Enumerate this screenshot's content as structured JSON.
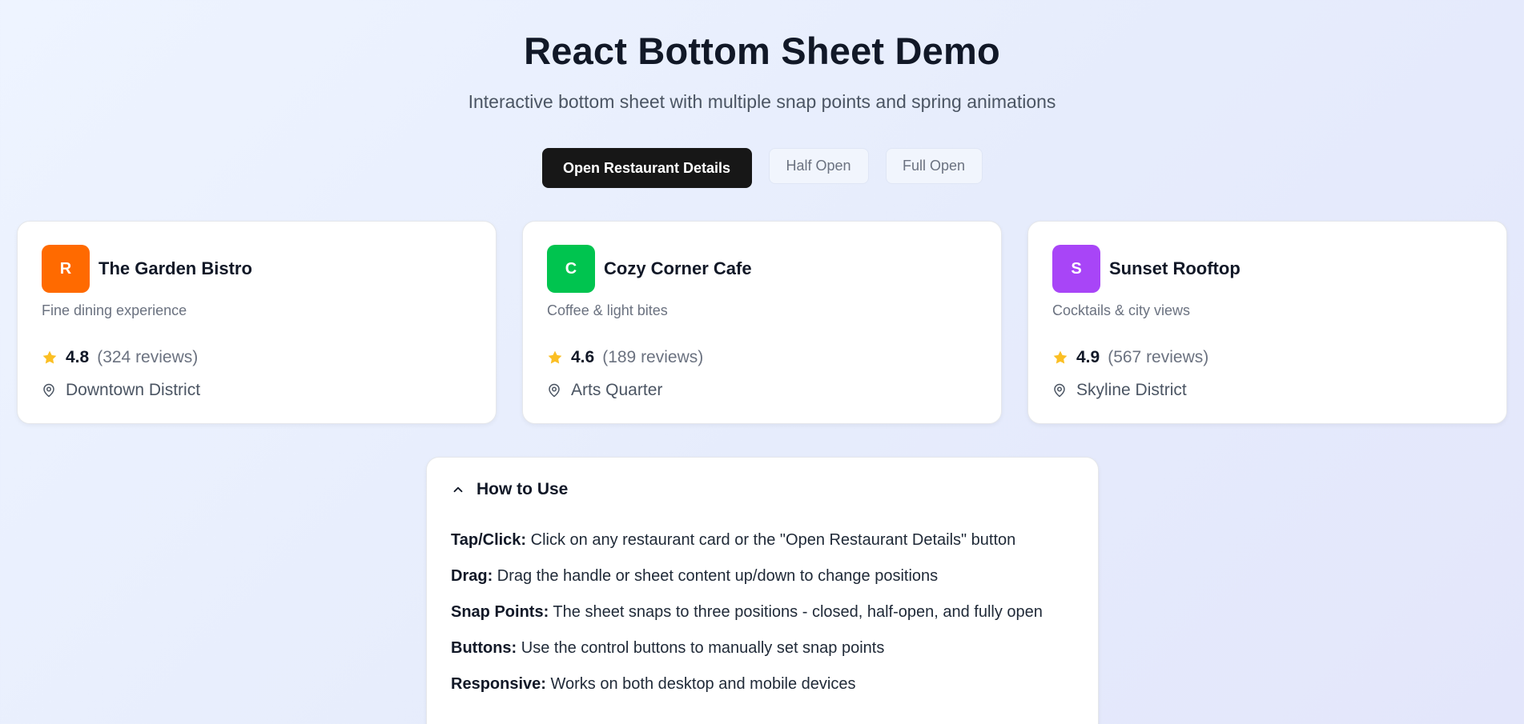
{
  "header": {
    "title": "React Bottom Sheet Demo",
    "subtitle": "Interactive bottom sheet with multiple snap points and spring animations"
  },
  "controls": {
    "open_label": "Open Restaurant Details",
    "half_label": "Half Open",
    "full_label": "Full Open"
  },
  "restaurants": [
    {
      "initial": "R",
      "name": "The Garden Bistro",
      "description": "Fine dining experience",
      "rating": "4.8",
      "reviews": "(324 reviews)",
      "location": "Downtown District",
      "color": "#ff6a00"
    },
    {
      "initial": "C",
      "name": "Cozy Corner Cafe",
      "description": "Coffee & light bites",
      "rating": "4.6",
      "reviews": "(189 reviews)",
      "location": "Arts Quarter",
      "color": "#00c44f"
    },
    {
      "initial": "S",
      "name": "Sunset Rooftop",
      "description": "Cocktails & city views",
      "rating": "4.9",
      "reviews": "(567 reviews)",
      "location": "Skyline District",
      "color": "#a845f7"
    }
  ],
  "howto": {
    "title": "How to Use",
    "items": [
      {
        "term": "Tap/Click:",
        "text": " Click on any restaurant card or the \"Open Restaurant Details\" button"
      },
      {
        "term": "Drag:",
        "text": " Drag the handle or sheet content up/down to change positions"
      },
      {
        "term": "Snap Points:",
        "text": " The sheet snaps to three positions - closed, half-open, and fully open"
      },
      {
        "term": "Buttons:",
        "text": " Use the control buttons to manually set snap points"
      },
      {
        "term": "Responsive:",
        "text": " Works on both desktop and mobile devices"
      }
    ]
  },
  "colors": {
    "star": "#fbbf24",
    "primary_button": "#171717"
  }
}
